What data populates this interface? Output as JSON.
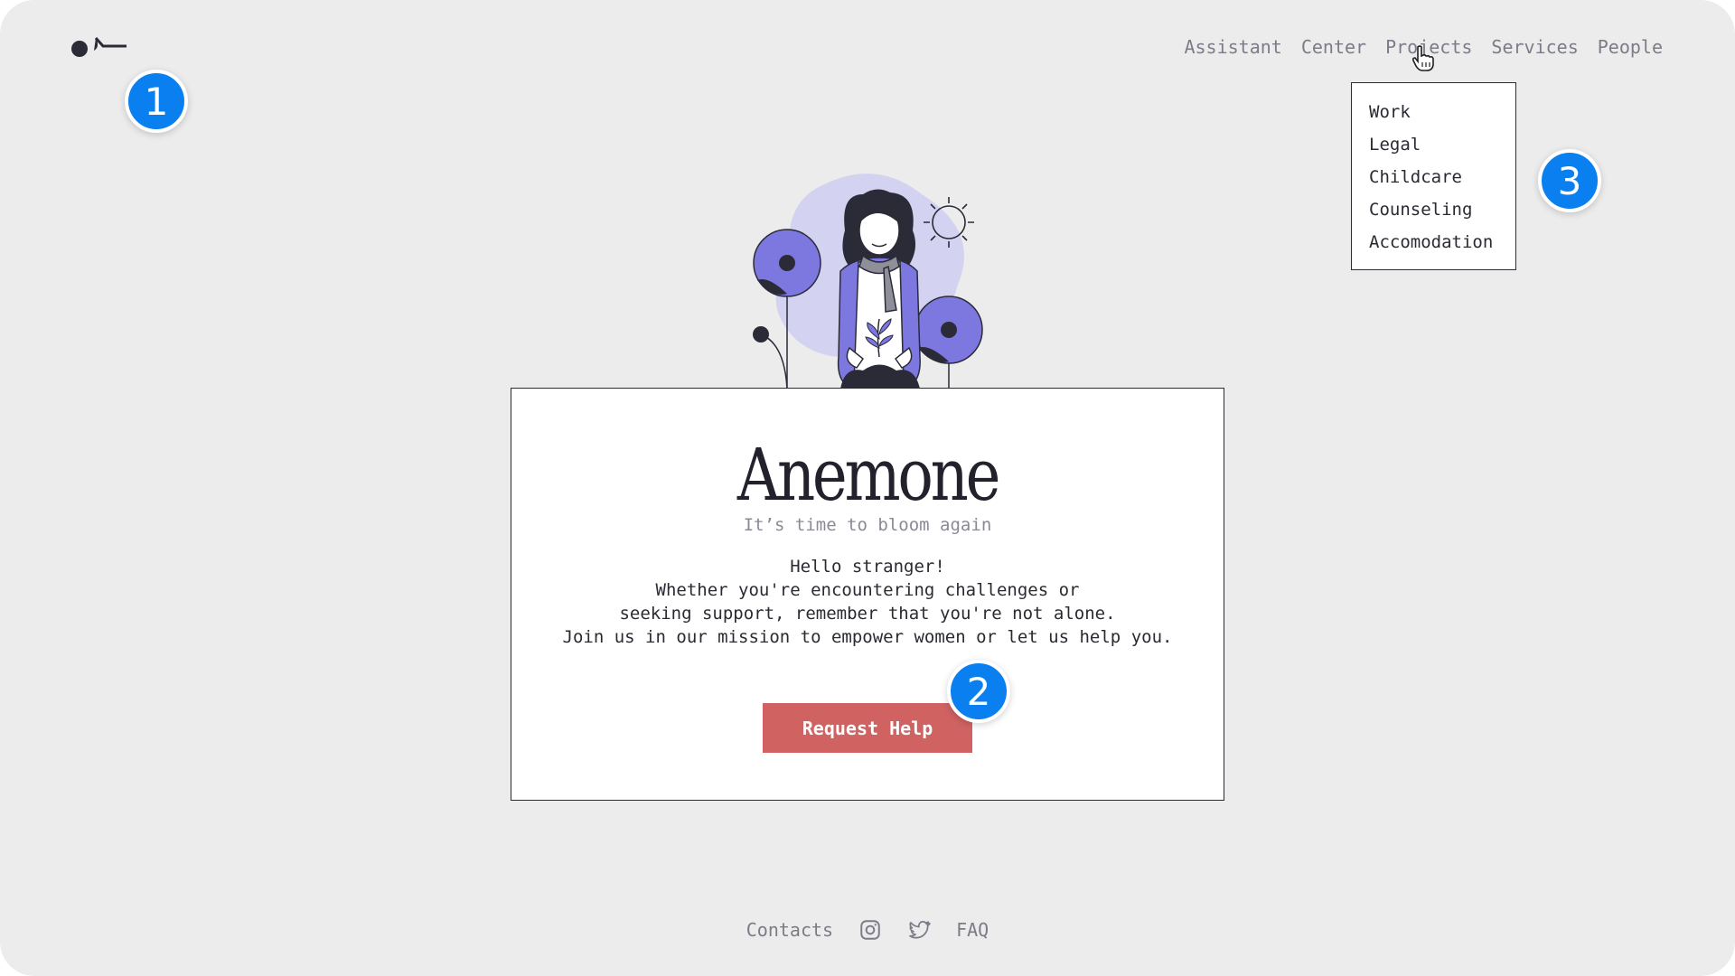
{
  "header": {
    "logo_icon": "anemone-logo-icon",
    "nav": [
      {
        "label": "Assistant"
      },
      {
        "label": "Center"
      },
      {
        "label": "Projects"
      },
      {
        "label": "Services"
      },
      {
        "label": "People"
      }
    ]
  },
  "dropdown": {
    "items": [
      {
        "label": "Work"
      },
      {
        "label": "Legal"
      },
      {
        "label": "Childcare"
      },
      {
        "label": "Counseling"
      },
      {
        "label": "Accomodation"
      }
    ]
  },
  "hero": {
    "title": "Anemone",
    "subtitle": "It’s time to bloom again",
    "body_lines": [
      "Hello stranger!",
      "Whether you're encountering challenges or",
      "seeking support, remember that you're not alone.",
      "Join us in our mission to empower women or let us help you."
    ],
    "cta_label": "Request Help"
  },
  "footer": {
    "contacts_label": "Contacts",
    "faq_label": "FAQ",
    "icons": [
      "instagram-icon",
      "twitter-icon"
    ]
  },
  "badges": [
    "1",
    "2",
    "3"
  ],
  "colors": {
    "background": "#ececec",
    "accent_purple": "#7c78e0",
    "blob_lavender": "#d3d2f1",
    "cta_red": "#d06262",
    "badge_blue": "#0a7ff0"
  }
}
